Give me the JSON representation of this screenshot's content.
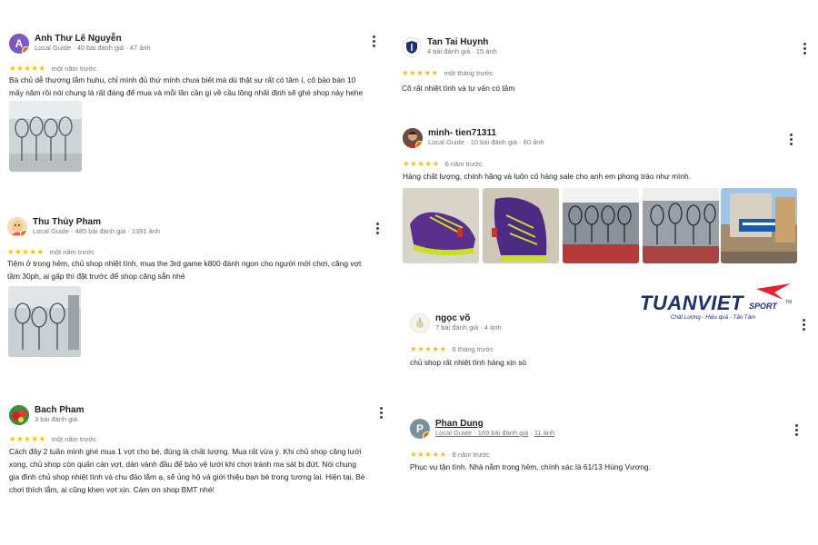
{
  "reviews": [
    {
      "name": "Anh Thư Lê Nguyễn",
      "meta": "Local Guide · 40 bài đánh giá · 47 ảnh",
      "avatar_letter": "A",
      "avatar_color": "#7e57c2",
      "stars": "★★★★★",
      "when": "một năm trước",
      "text_lines": [
        "Bà chủ dễ thương lắm huhu, chỉ mình đủ thứ mình chưa biết mà dù thật sự rất có tâm í, cô bảo bán 10",
        "mấy năm rồi nói chung là rất đáng để mua và mỗi lần cần gì về cầu lông nhất định sẽ ghé shop này hehe"
      ]
    },
    {
      "name": "Thu Thủy Pham",
      "meta": "Local Guide · 485 bài đánh giá · 1391 ảnh",
      "stars": "★★★★★",
      "when": "một năm trước",
      "text_lines": [
        "Tiệm ở trong hẻm, chủ shop nhiệt tình, mua the 3rd game k800 đánh ngon cho người mới chơi, căng vợt",
        "tầm 30ph, ai gấp thì đặt trước để shop căng sẵn nhé"
      ]
    },
    {
      "name": "Bach Pham",
      "meta": "3 bài đánh giá",
      "stars": "★★★★★",
      "when": "một năm trước",
      "text_lines": [
        "Cách đây 2 tuần mình ghé mua 1 vợt cho bé, đúng là chất lượng. Mua rất vừa ý. Khi chủ shop căng lưới",
        "xong, chủ shop còn quấn cán vợt, dán vành đầu để bảo vệ lưới khi chơi tránh ma sát bị đứt. Nói chung",
        "gia đình chủ shop nhiệt tình và chu đáo lắm ạ, sẽ ủng hộ và giới thiệu bạn bè trong tương lai. Hiện tại, Bé",
        "chơi thích lắm, ai cũng khen vợt xịn. Cám ơn shop BMT nhé!"
      ]
    },
    {
      "name": "Tan Tai Huynh",
      "meta": "4 bài đánh giá · 15 ảnh",
      "stars": "★★★★★",
      "when": "một tháng trước",
      "text_lines": [
        "Cô rất nhiệt tình và tư vấn có tâm"
      ]
    },
    {
      "name": "minh- tien71311",
      "meta": "Local Guide · 10 bài đánh giá · 60 ảnh",
      "stars": "★★★★★",
      "when": "6 năm trước",
      "text_lines": [
        "Hàng chất lượng, chính hãng và luôn có hàng sale cho anh em phong trào như mình."
      ]
    },
    {
      "name": "ngọc võ",
      "meta": "7 bài đánh giá · 4 ảnh",
      "stars": "★★★★★",
      "when": "6 tháng trước",
      "text_lines": [
        "chủ shop rất nhiệt tình hàng xịn sò"
      ]
    },
    {
      "name": "Phan Dung",
      "meta_prefix": "Local Guide · ",
      "meta_count": "169 bài đánh giá",
      "meta_sep": " · ",
      "meta_photos": "11 ảnh",
      "avatar_letter": "P",
      "avatar_color": "#78909c",
      "stars": "★★★★★",
      "when": "8 năm trước",
      "text_lines": [
        "Phục vụ tận tình. Nhà nằm trong hẻm, chính xác là 61/13 Hùng Vương."
      ]
    }
  ],
  "logo": {
    "brand_main": "TUANVIET",
    "brand_sub": "SPORT",
    "tm": "TM",
    "tagline": "Chất Lượng - Hiệu quả - Tận Tâm",
    "brand_color": "#1c2f6b",
    "accent_color": "#e0242b"
  },
  "photo_icons": {
    "rackets": "rackets-photo",
    "shoe": "shoe-photo",
    "storefront": "storefront-photo"
  }
}
